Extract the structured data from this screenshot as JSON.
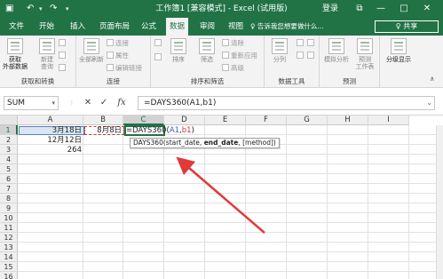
{
  "titlebar": {
    "undo_icon": "undo-icon",
    "redo_icon": "redo-icon",
    "title": "工作簿1 [兼容模式] - Excel (试用版)",
    "login_label": "登录",
    "restore_glyph": "⧉",
    "minimize_glyph": "—",
    "maximize_glyph": "□",
    "close_glyph": "✕"
  },
  "ribbon_tabs": [
    {
      "label": "文件"
    },
    {
      "label": "开始"
    },
    {
      "label": "插入"
    },
    {
      "label": "页面布局"
    },
    {
      "label": "公式"
    },
    {
      "label": "数据",
      "active": true
    },
    {
      "label": "审阅"
    },
    {
      "label": "视图"
    }
  ],
  "tell_me": "♀ 告诉我您想要做什么...",
  "share_label": "♀ 共享",
  "ribbon": {
    "get_external": "获取\n外部数据",
    "new_query": "新建\n查询",
    "refresh_all": "全部刷新",
    "connections": "连接",
    "properties": "属性",
    "edit_links": "编辑链接",
    "sort": "排序",
    "filter": "筛选",
    "clear": "清除",
    "reapply": "重新应用",
    "advanced": "高级",
    "text_to_columns": "分列",
    "what_if": "模拟分析",
    "forecast_sheet": "预测\n工作表",
    "outline": "分级显示",
    "group_labels": {
      "get_transform": "获取和转换",
      "connections": "连接",
      "sort_filter": "排序和筛选",
      "data_tools": "数据工具",
      "forecast": "预测"
    }
  },
  "formula_bar": {
    "name_box": "SUM",
    "cancel_glyph": "✕",
    "enter_glyph": "✓",
    "fx_glyph": "fx",
    "formula": "=DAYS360(A1,b1)"
  },
  "columns": [
    "A",
    "B",
    "C",
    "D",
    "E",
    "F",
    "G",
    "H",
    "I"
  ],
  "rows": [
    "1",
    "2",
    "3",
    "4",
    "5",
    "6",
    "7",
    "8",
    "9",
    "10",
    "11",
    "12",
    "13",
    "14",
    "15",
    "16"
  ],
  "cells": {
    "A1": "3月18日",
    "B1": "8月8日",
    "A2": "12月12日",
    "A3": "264"
  },
  "edit_cell": {
    "prefix": "=DAYS360(",
    "ref_a": "A1",
    "sep": ",",
    "ref_b": "b1",
    "suffix": ")"
  },
  "tooltip": {
    "func": "DAYS360(",
    "arg1": "start_date, ",
    "arg2": "end_date",
    "rest": ", [method])"
  },
  "arrow_color": "#e03a3a"
}
